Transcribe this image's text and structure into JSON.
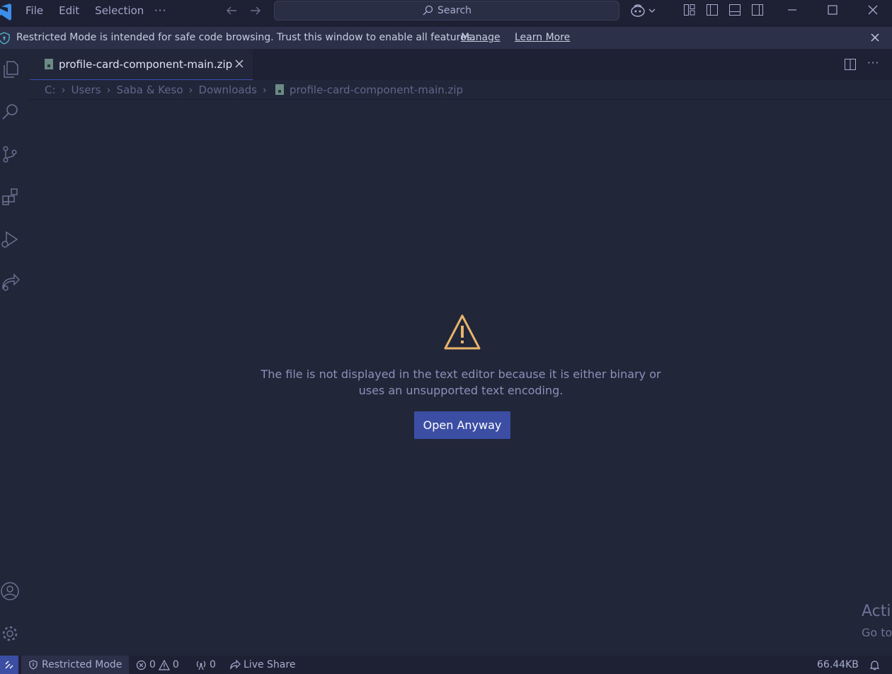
{
  "menu": {
    "file": "File",
    "edit": "Edit",
    "selection": "Selection",
    "more": "···"
  },
  "search": {
    "placeholder": "Search"
  },
  "banner": {
    "message": "Restricted Mode is intended for safe code browsing. Trust this window to enable all features.",
    "manage": "Manage",
    "learn_more": "Learn More"
  },
  "tab": {
    "label": "profile-card-component-main.zip"
  },
  "breadcrumb": [
    "C:",
    "Users",
    "Saba & Keso",
    "Downloads",
    "profile-card-component-main.zip"
  ],
  "editor": {
    "message_line1": "The file is not displayed in the text editor because it is either binary or",
    "message_line2": "uses an unsupported text encoding.",
    "open_anyway": "Open Anyway",
    "watermark_line1": "Acti",
    "watermark_line2": "Go to"
  },
  "status": {
    "restricted": "Restricted Mode",
    "errors": "0",
    "warnings": "0",
    "ports": "0",
    "live_share": "Live Share",
    "size": "66.44KB"
  },
  "colors": {
    "accent": "#3c4ea3",
    "warning": "#e8b36b",
    "background": "#222639"
  }
}
